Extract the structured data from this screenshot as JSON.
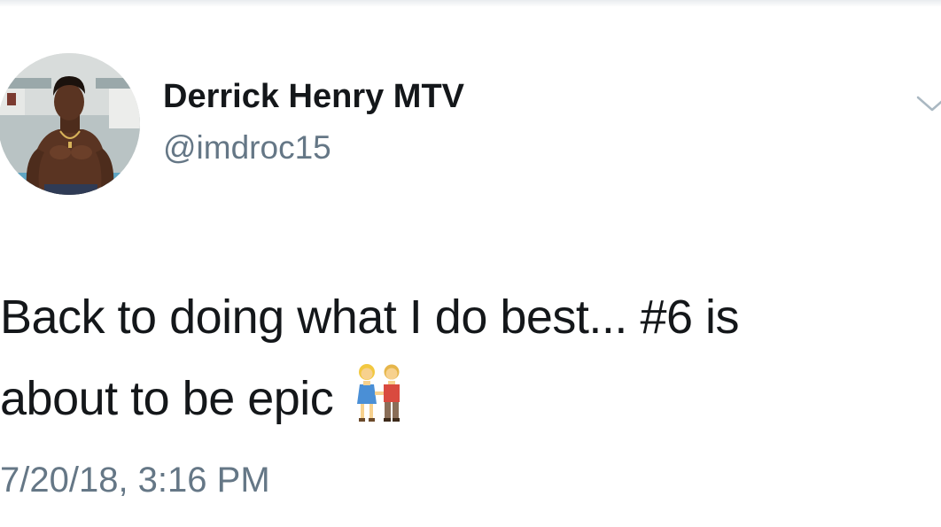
{
  "tweet": {
    "display_name": "Derrick Henry MTV",
    "handle": "@imdroc15",
    "text_line1": "Back to doing what I do best... #6 is",
    "text_line2": "about to be epic",
    "emoji": "couple-holding-hands-emoji",
    "timestamp": "7/20/18, 3:16 PM"
  },
  "colors": {
    "text_primary": "#14171a",
    "text_secondary": "#657786",
    "chevron": "#aab8c2"
  },
  "icons": {
    "menu": "chevron-down-icon",
    "avatar": "profile-photo"
  }
}
